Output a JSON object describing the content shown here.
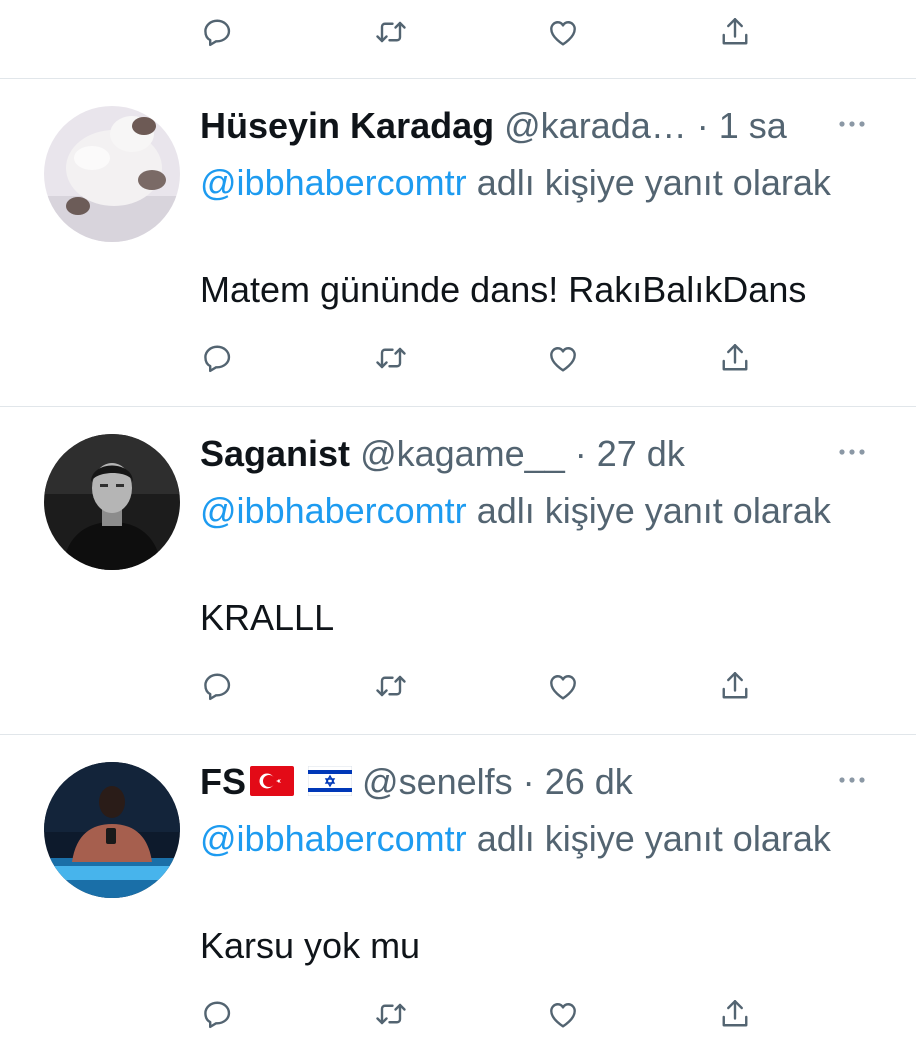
{
  "icons": {
    "reply": "reply-icon",
    "retweet": "retweet-icon",
    "like": "heart-icon",
    "share": "share-icon",
    "more": "more-icon"
  },
  "colors": {
    "link": "#1d9bf0",
    "secondary_text": "#536471",
    "primary_text": "#0f1419",
    "divider": "#e1e6ea"
  },
  "tweets": [
    {
      "name": "Hüseyin Karadag",
      "handle": "@karada…",
      "dot": "·",
      "time": "1 sa",
      "reply_mention": "@ibbhabercomtr",
      "reply_suffix": "adlı kişiye yanıt olarak",
      "text": "Matem gününde dans! RakıBalıkDans"
    },
    {
      "name": "Saganist",
      "handle": "@kagame__",
      "dot": "·",
      "time": "27 dk",
      "reply_mention": "@ibbhabercomtr",
      "reply_suffix": "adlı kişiye yanıt olarak",
      "text": "KRALLL"
    },
    {
      "name": "FS",
      "flags": [
        "turkey-flag-icon",
        "israel-flag-icon"
      ],
      "handle": "@senelfs",
      "dot": "·",
      "time": "26 dk",
      "reply_mention": "@ibbhabercomtr",
      "reply_suffix": "adlı kişiye yanıt olarak",
      "text": "Karsu yok mu"
    }
  ]
}
